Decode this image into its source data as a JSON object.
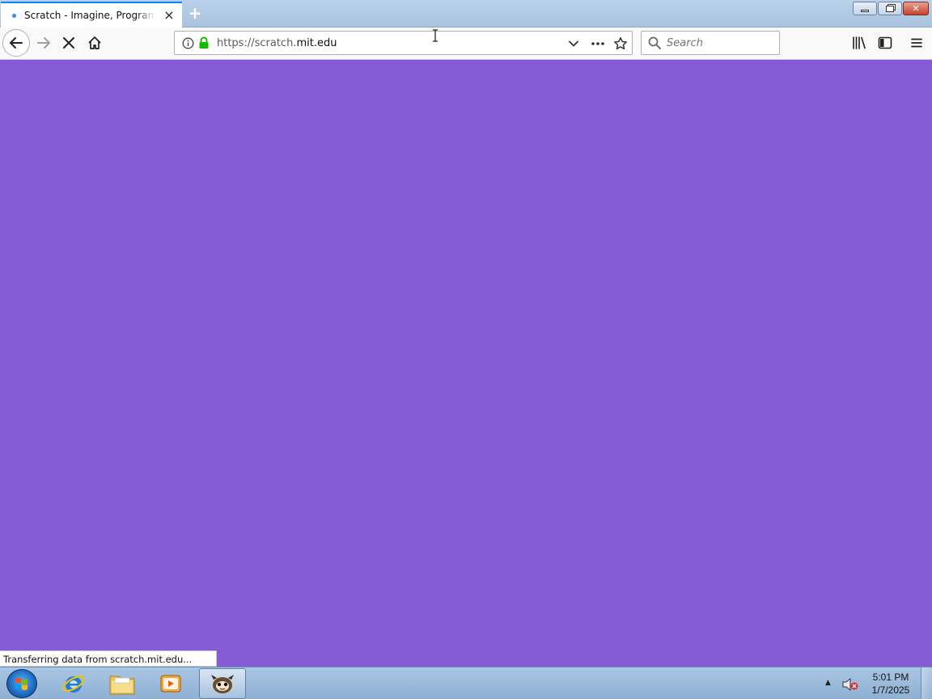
{
  "browser": {
    "tab": {
      "title": "Scratch - Imagine, Program, Share",
      "close_glyph": "×",
      "new_tab_glyph": "+"
    },
    "window_buttons": {
      "close_glyph": "✕"
    },
    "url": {
      "prefix": "https://scratch.",
      "host": "mit.edu"
    },
    "search": {
      "placeholder": "Search"
    },
    "icons": {
      "back": "arrow-left-icon",
      "forward": "arrow-right-icon",
      "stop": "stop-icon",
      "home": "home-icon",
      "info": "info-icon",
      "lock": "lock-icon",
      "dropdown": "chevron-down-icon",
      "page_actions": "more-icon",
      "bookmark": "star-icon",
      "library": "library-icon",
      "sidebar": "sidebar-icon",
      "menu": "hamburger-menu-icon"
    }
  },
  "page": {
    "background_color": "#855cd6"
  },
  "status": {
    "text": "Transferring data from scratch.mit.edu..."
  },
  "taskbar": {
    "clock_time": "5:01 PM",
    "clock_date": "1/7/2025",
    "items": [
      "internet-explorer",
      "file-explorer",
      "media-player",
      "firefox"
    ]
  },
  "colors": {
    "accent": "#0a84ff",
    "lock_green": "#12bc00"
  }
}
